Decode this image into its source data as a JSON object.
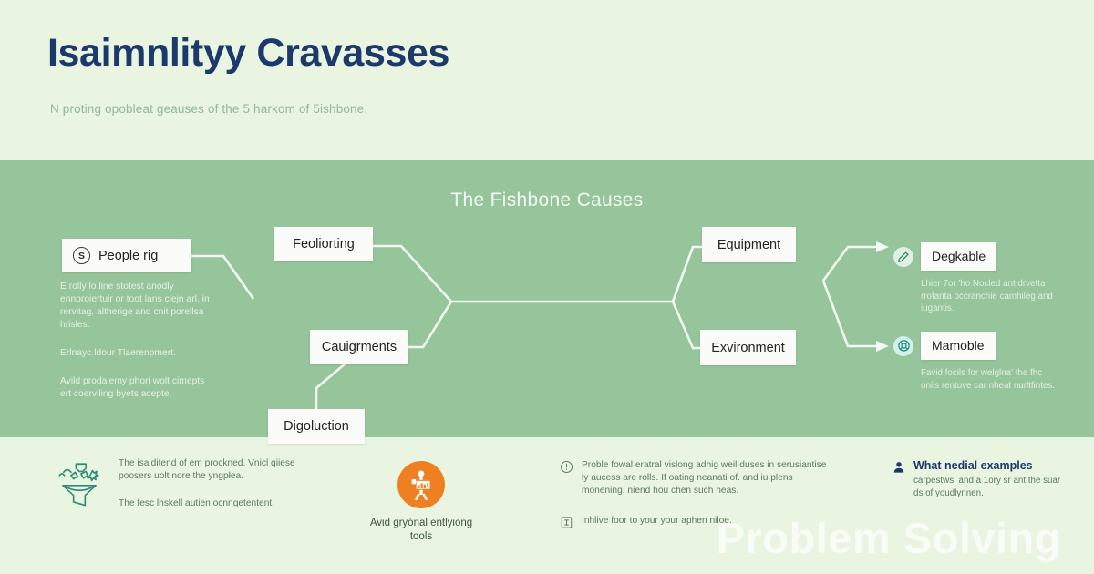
{
  "header": {
    "title": "Isaimnlityy Cravasses",
    "subtitle": "N proting opobleat geauses of the 5 harkom of 5ishbone."
  },
  "diagram": {
    "title": "The Fishbone Causes",
    "categories": {
      "people": {
        "badge": "S",
        "label": "People rig"
      },
      "feoliorting": {
        "label": "Feoliorting"
      },
      "cauigrments": {
        "label": "Cauigrments"
      },
      "digoluction": {
        "label": "Digoluction"
      },
      "equipment": {
        "label": "Equipment"
      },
      "exvironment": {
        "label": "Exvironment"
      }
    },
    "left_notes": [
      "E rolly lo line stotest anodly ennproiertuir or toot lans clejn arl, in rervitag, altherige and cnit porellsa hrisleѕ.",
      "Erlnayc.ldour Tlaerenpmert.",
      "Avild prodalemy phori wolt cimepts ert coerviling byets acepte."
    ],
    "right_items": [
      {
        "icon": "pen-icon",
        "label": "Degkable",
        "desc": "Lhier 7or 'ho Nocled ant drvetta rrofanta occranchie camhileg and iugantis."
      },
      {
        "icon": "lifebuoy-icon",
        "label": "Mamoble",
        "desc": "Favid focils for welglna' the fhc onils rentuve car nheat nurltfintes."
      }
    ]
  },
  "bottom": {
    "left": {
      "icon": "funnel-icon",
      "lines": [
        "The isaiditend of em prockned. Vnicl qiiese poosers uolt nore the yngpłea.",
        "The fesc lhskell autien ocnngetentent."
      ]
    },
    "orange": {
      "icon": "person-chart-icon",
      "caption": "Avid gryónal entlyiong tools"
    },
    "middle": [
      {
        "icon": "info-circle-icon",
        "text": "Proble fowal eratral vislong adhig weil duses in serusiantise ly aucess are rolls. If oating neanati of. and iu plens monening, niend hou chen such heas."
      },
      {
        "icon": "document-icon",
        "text": "Inhlive foor to your your aphen niloe."
      }
    ],
    "right": {
      "icon": "user-badge-icon",
      "title": "What nedial examples",
      "desc": "carpestws, and a 1ory sr ant the suar ds of youdlynnen."
    }
  },
  "watermark": "Problem Solving",
  "colors": {
    "band_light": "#e9f4e1",
    "band_mid": "#96c49b",
    "title_navy": "#1b3a6b",
    "accent_orange": "#ef8022",
    "accent_teal": "#2e8b78"
  }
}
